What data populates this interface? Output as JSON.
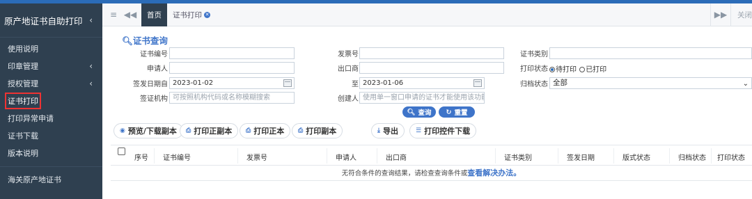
{
  "sidebar": {
    "title": "原产地证书自助打印",
    "items": [
      {
        "label": "使用说明",
        "chevron": false
      },
      {
        "label": "印章管理",
        "chevron": true
      },
      {
        "label": "授权管理",
        "chevron": true
      },
      {
        "label": "证书打印",
        "chevron": false,
        "active": true
      },
      {
        "label": "打印异常申请",
        "chevron": false
      },
      {
        "label": "证书下载",
        "chevron": false
      },
      {
        "label": "版本说明",
        "chevron": false
      }
    ],
    "footer": "海关原产地证书"
  },
  "tabbar": {
    "home": "首页",
    "current": "证书打印",
    "right_text": "关闭"
  },
  "query": {
    "title": "证书查询",
    "cert_no_label": "证书编号",
    "invoice_no_label": "发票号",
    "cert_type_label": "证书类别",
    "applicant_label": "申请人",
    "exporter_label": "出口商",
    "print_status_label": "打印状态",
    "print_status_options": [
      "待打印",
      "已打印"
    ],
    "issue_date_label": "签发日期自",
    "issue_date_from": "2023-01-02",
    "to_label": "至",
    "issue_date_to": "2023-01-06",
    "archive_status_label": "归档状态",
    "archive_status_value": "全部",
    "agency_label": "签证机构",
    "agency_placeholder": "可按照机构代码或名称模糊搜索",
    "creator_label": "创建人",
    "creator_placeholder": "使用单一窗口申请的证书才能使用该功能",
    "search_btn": "查询",
    "reset_btn": "重置"
  },
  "toolbar": {
    "preview": "预览/下载副本",
    "print_copy": "打印正副本",
    "print_original": "打印正本",
    "print_duplicate": "打印副本",
    "export": "导出",
    "print_ctrl": "打印控件下载"
  },
  "table": {
    "columns": [
      "序号",
      "证书编号",
      "发票号",
      "申请人",
      "出口商",
      "证书类别",
      "签发日期",
      "版式状态",
      "归档状态",
      "打印状态"
    ],
    "empty_text": "无符合条件的查询结果，请检查查询条件或",
    "empty_link": "查看解决办法。"
  },
  "colors": {
    "sidebar_bg": "#2f4050",
    "accent": "#3e74c9",
    "top_strip": "#2b6cb8"
  }
}
